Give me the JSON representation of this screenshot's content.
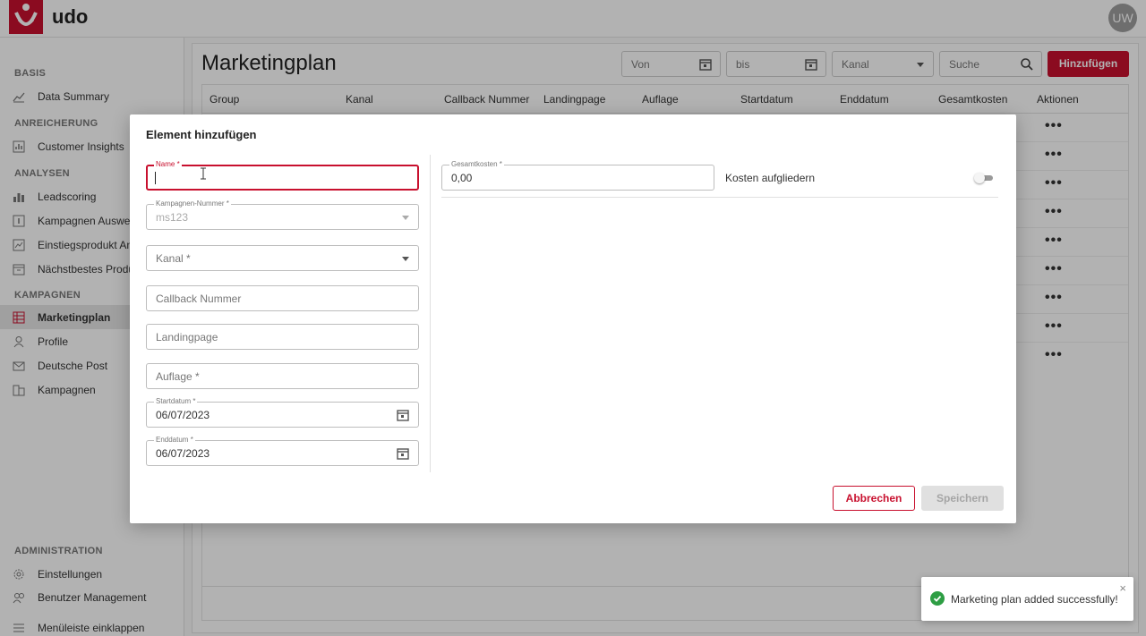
{
  "app": {
    "name": "udo",
    "user_initials": "UW",
    "brand_color": "#c8102e"
  },
  "sidebar": {
    "sections": [
      {
        "title": "BASIS",
        "items": [
          {
            "label": "Data Summary",
            "icon": "data-summary-icon"
          }
        ]
      },
      {
        "title": "ANREICHERUNG",
        "items": [
          {
            "label": "Customer Insights",
            "icon": "insights-icon"
          }
        ]
      },
      {
        "title": "ANALYSEN",
        "items": [
          {
            "label": "Leadscoring",
            "icon": "bar-chart-icon"
          },
          {
            "label": "Kampagnen Auswertung",
            "icon": "campaign-eval-icon"
          },
          {
            "label": "Einstiegsprodukt Analyse",
            "icon": "line-chart-icon"
          },
          {
            "label": "Nächstbestes Produkt",
            "icon": "box-icon"
          }
        ]
      },
      {
        "title": "KAMPAGNEN",
        "items": [
          {
            "label": "Marketingplan",
            "icon": "calendar-grid-icon",
            "active": true
          },
          {
            "label": "Profile",
            "icon": "person-icon"
          },
          {
            "label": "Deutsche Post",
            "icon": "mail-icon"
          },
          {
            "label": "Kampagnen",
            "icon": "buildings-icon"
          }
        ]
      },
      {
        "title": "ADMINISTRATION",
        "items": [
          {
            "label": "Einstellungen",
            "icon": "gear-icon"
          },
          {
            "label": "Benutzer Management",
            "icon": "users-icon"
          }
        ]
      }
    ],
    "collapse_label": "Menüleiste einklappen"
  },
  "page": {
    "title": "Marketingplan",
    "filters": {
      "from_placeholder": "Von",
      "to_placeholder": "bis",
      "channel_placeholder": "Kanal",
      "search_placeholder": "Suche"
    },
    "add_button": "Hinzufügen",
    "table": {
      "columns": [
        "Group",
        "Kanal",
        "Callback Nummer",
        "Landingpage",
        "Auflage",
        "Startdatum",
        "Enddatum",
        "Gesamtkosten",
        "Aktionen"
      ],
      "row_count": 9,
      "row_action": "•••"
    }
  },
  "modal": {
    "title": "Element hinzufügen",
    "fields": {
      "name": {
        "label": "Name *",
        "value": ""
      },
      "kampagnen_nummer": {
        "label": "Kampagnen-Nummer *",
        "value": "ms123"
      },
      "kanal": {
        "placeholder": "Kanal *"
      },
      "callback": {
        "placeholder": "Callback Nummer"
      },
      "landingpage": {
        "placeholder": "Landingpage"
      },
      "auflage": {
        "placeholder": "Auflage *"
      },
      "startdatum": {
        "label": "Startdatum *",
        "value": "06/07/2023"
      },
      "enddatum": {
        "label": "Enddatum *",
        "value": "06/07/2023"
      },
      "gesamtkosten": {
        "label": "Gesamtkosten *",
        "value": "0,00"
      }
    },
    "kosten_toggle_label": "Kosten aufgliedern",
    "kosten_toggle_on": false,
    "cancel_button": "Abbrechen",
    "save_button": "Speichern"
  },
  "toast": {
    "message": "Marketing plan added successfully!",
    "close": "×",
    "status_color": "#2e9e44"
  }
}
